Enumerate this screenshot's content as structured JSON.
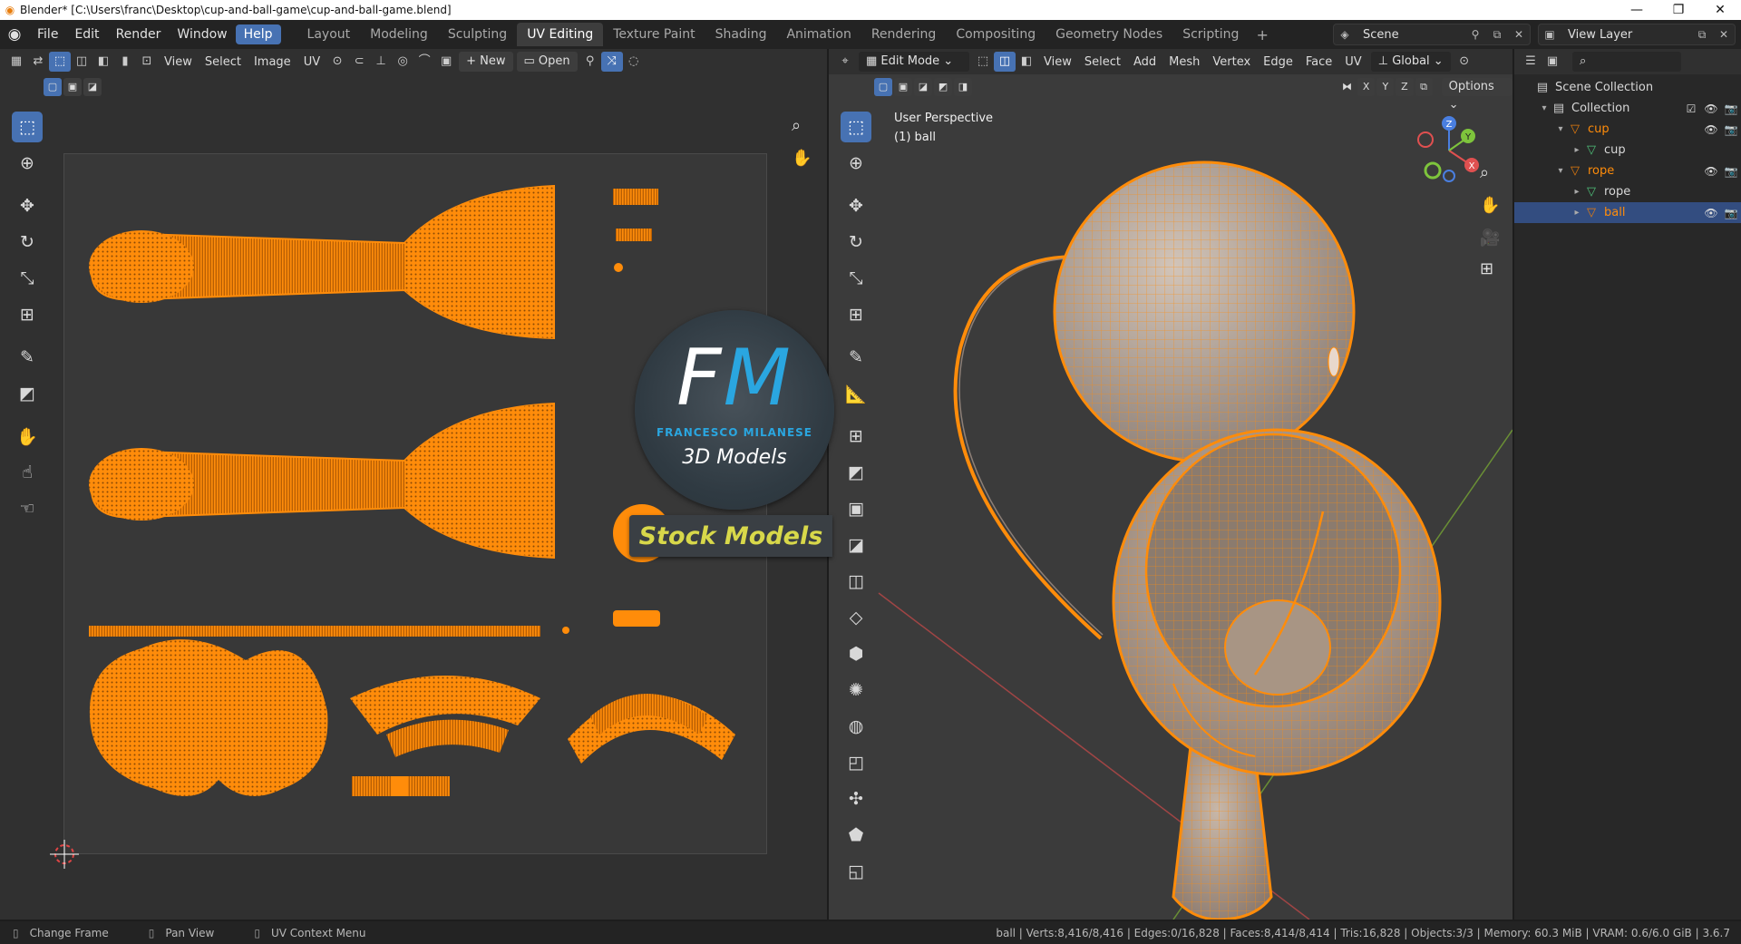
{
  "window": {
    "title": "Blender* [C:\\Users\\franc\\Desktop\\cup-and-ball-game\\cup-and-ball-game.blend]",
    "controls": [
      "—",
      "❐",
      "✕"
    ]
  },
  "topbar": {
    "menus": [
      "File",
      "Edit",
      "Render",
      "Window",
      "Help"
    ],
    "workspaces": [
      "Layout",
      "Modeling",
      "Sculpting",
      "UV Editing",
      "Texture Paint",
      "Shading",
      "Animation",
      "Rendering",
      "Compositing",
      "Geometry Nodes",
      "Scripting"
    ],
    "active_workspace": "UV Editing",
    "scene": "Scene",
    "view_layer": "View Layer"
  },
  "uv_editor": {
    "menus": [
      "View",
      "Select",
      "Image",
      "UV"
    ],
    "new_label": "New",
    "open_label": "Open"
  },
  "viewport": {
    "mode": "Edit Mode",
    "menus": [
      "View",
      "Select",
      "Add",
      "Mesh",
      "Vertex",
      "Edge",
      "Face",
      "UV"
    ],
    "orientation": "Global",
    "options_label": "Options",
    "axes": [
      "X",
      "Y",
      "Z"
    ],
    "view_name": "User Perspective",
    "object_label": "(1) ball"
  },
  "outliner": {
    "rows": [
      {
        "name": "Scene Collection",
        "indent": 0,
        "icon": "▤",
        "color": "#cccccc",
        "selected": false
      },
      {
        "name": "Collection",
        "indent": 1,
        "icon": "▤",
        "color": "#cccccc",
        "selected": false
      },
      {
        "name": "cup",
        "indent": 2,
        "icon": "▽",
        "color": "#e87d0d",
        "selected": true
      },
      {
        "name": "cup",
        "indent": 3,
        "icon": "▽",
        "color": "#4fc27a",
        "selected": false
      },
      {
        "name": "rope",
        "indent": 2,
        "icon": "▽",
        "color": "#e87d0d",
        "selected": true
      },
      {
        "name": "rope",
        "indent": 3,
        "icon": "▽",
        "color": "#4fc27a",
        "selected": false
      },
      {
        "name": "ball",
        "indent": 3,
        "icon": "▽",
        "color": "#e87d0d",
        "selected": true
      }
    ]
  },
  "watermark": {
    "letters_f": "F",
    "letters_m": "M",
    "name": "FRANCESCO MILANESE",
    "subtitle": "3D Models",
    "banner": "Stock Models"
  },
  "status": {
    "hints": [
      "Change Frame",
      "Pan View",
      "UV Context Menu"
    ],
    "stats": "ball | Verts:8,416/8,416 | Edges:0/16,828 | Faces:8,414/8,414 | Tris:16,828 | Objects:3/3 | Memory: 60.3 MiB | VRAM: 0.6/6.0 GiB | 3.6.7"
  },
  "colors": {
    "accent": "#4772b3",
    "selection_orange": "#ff8c0a",
    "brand_blue": "#2aa6e0"
  }
}
